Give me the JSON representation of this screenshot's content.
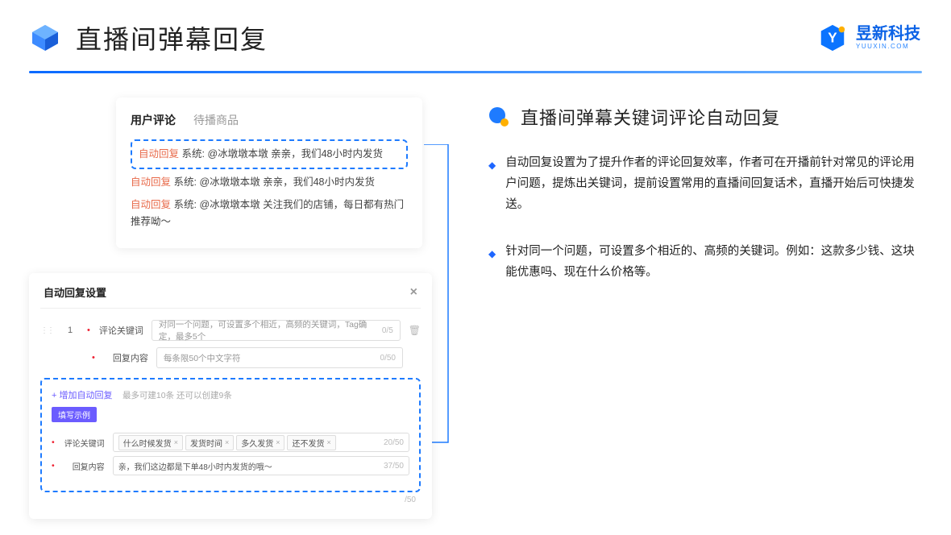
{
  "header": {
    "title": "直播间弹幕回复"
  },
  "brand": {
    "cn": "昱新科技",
    "en": "YUUXIN.COM"
  },
  "comments": {
    "tabs": {
      "active": "用户评论",
      "inactive": "待播商品"
    },
    "rows": [
      {
        "tag": "自动回复",
        "text": "系统: @冰墩墩本墩 亲亲，我们48小时内发货"
      },
      {
        "tag": "自动回复",
        "text": "系统: @冰墩墩本墩 亲亲，我们48小时内发货"
      },
      {
        "tag": "自动回复",
        "text": "系统: @冰墩墩本墩 关注我们的店铺，每日都有热门推荐呦～"
      }
    ]
  },
  "settings": {
    "title": "自动回复设置",
    "idx": "1",
    "kw_label": "评论关键词",
    "kw_placeholder": "对同一个问题，可设置多个相近，高频的关键词，Tag确定，最多5个",
    "kw_count": "0/5",
    "content_label": "回复内容",
    "content_placeholder": "每条限50个中文字符",
    "content_count": "0/50",
    "add_link": "+ 增加自动回复",
    "add_tip": "最多可建10条 还可以创建9条",
    "example_badge": "填写示例",
    "ex_kw_label": "评论关键词",
    "ex_tags": [
      "什么时候发货",
      "发货时间",
      "多久发货",
      "还不发货"
    ],
    "ex_kw_count": "20/50",
    "ex_content_label": "回复内容",
    "ex_content_text": "亲，我们这边都是下单48小时内发货的哦～",
    "ex_content_count": "37/50",
    "outer_count": "/50"
  },
  "right": {
    "title": "直播间弹幕关键词评论自动回复",
    "p1": "自动回复设置为了提升作者的评论回复效率，作者可在开播前针对常见的评论用户问题，提炼出关键词，提前设置常用的直播间回复话术，直播开始后可快捷发送。",
    "p2": "针对同一个问题，可设置多个相近的、高频的关键词。例如：这款多少钱、这块能优惠吗、现在什么价格等。"
  }
}
